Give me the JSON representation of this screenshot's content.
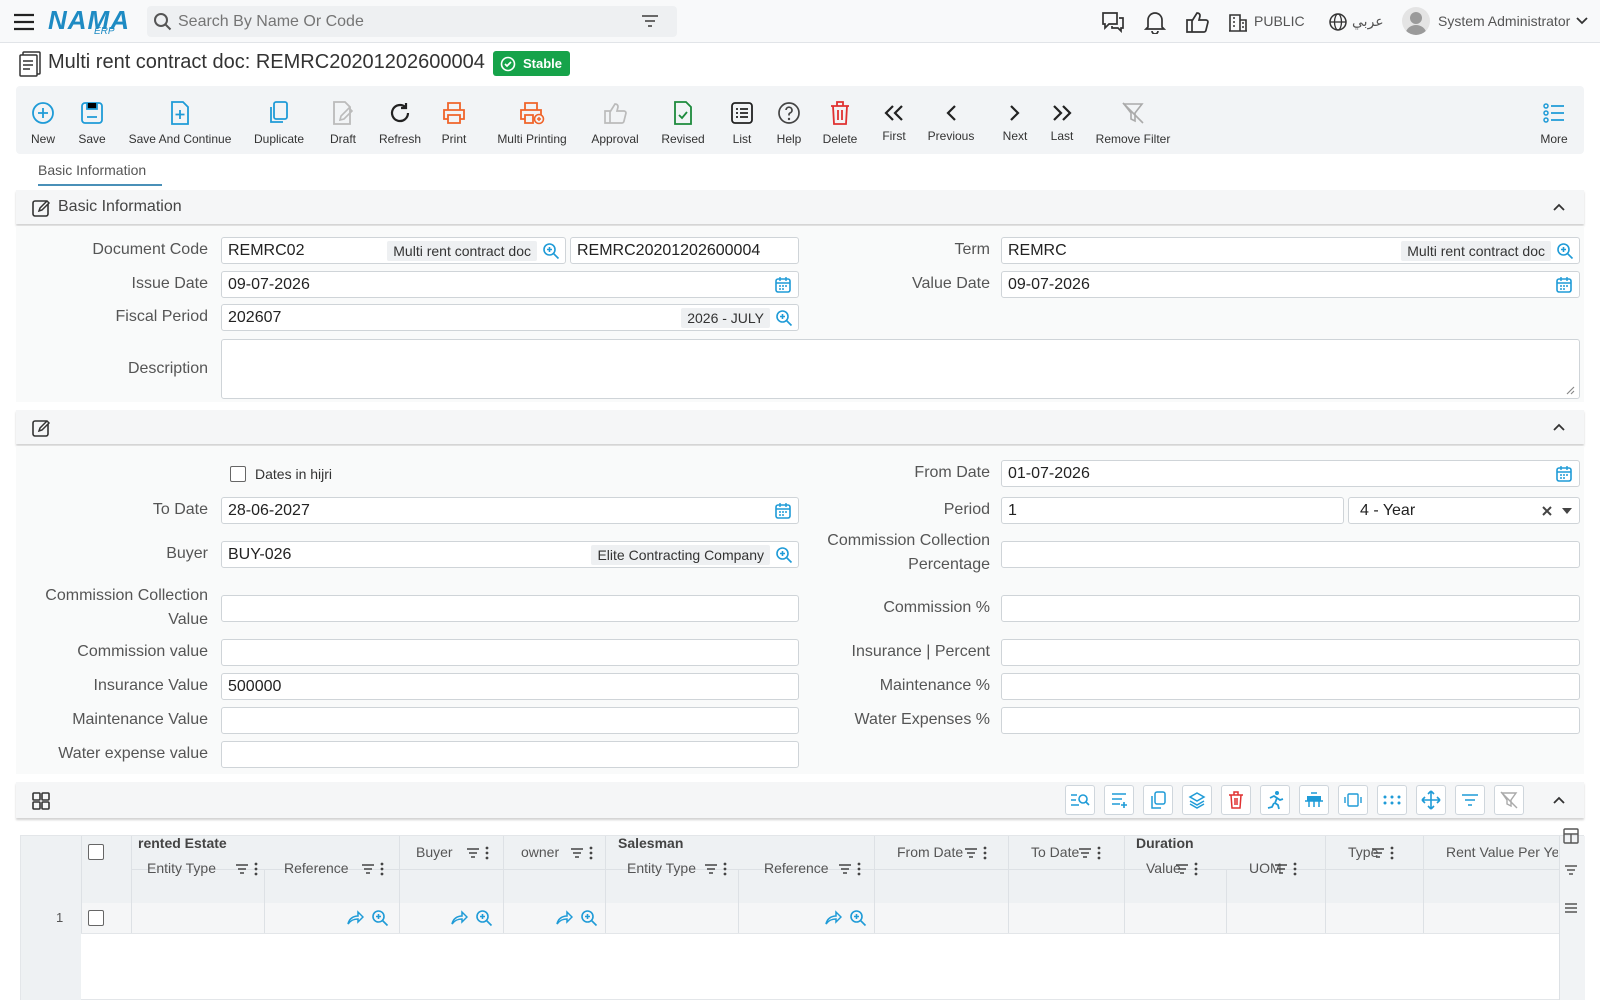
{
  "header": {
    "logo": "NAMA",
    "logo_sub": "ERP",
    "search_placeholder": "Search By Name Or Code",
    "public_label": "PUBLIC",
    "lang_label": "عربي",
    "user_name": "System Administrator"
  },
  "page": {
    "title": "Multi rent contract doc: REMRC20201202600004",
    "status": "Stable"
  },
  "toolbar": {
    "new": "New",
    "save": "Save",
    "save_continue": "Save And Continue",
    "duplicate": "Duplicate",
    "draft": "Draft",
    "refresh": "Refresh",
    "print": "Print",
    "multi_printing": "Multi Printing",
    "approval": "Approval",
    "revised": "Revised",
    "list": "List",
    "help": "Help",
    "delete": "Delete",
    "first": "First",
    "previous": "Previous",
    "next": "Next",
    "last": "Last",
    "remove_filter": "Remove Filter",
    "more": "More"
  },
  "tabs": {
    "basic": "Basic Information"
  },
  "section1": {
    "title": "Basic Information"
  },
  "fields": {
    "doc_code_label": "Document Code",
    "doc_code": "REMRC02",
    "doc_code_tag": "Multi rent contract doc",
    "doc_number": "REMRC20201202600004",
    "term_label": "Term",
    "term": "REMRC",
    "term_tag": "Multi rent contract doc",
    "issue_date_label": "Issue Date",
    "issue_date": "09-07-2026",
    "value_date_label": "Value Date",
    "value_date": "09-07-2026",
    "fiscal_label": "Fiscal Period",
    "fiscal": "202607",
    "fiscal_tag": "2026 - JULY",
    "desc_label": "Description",
    "hijri_label": "Dates in hijri",
    "from_date_label": "From Date",
    "from_date": "01-07-2026",
    "to_date_label": "To Date",
    "to_date": "28-06-2027",
    "period_label": "Period",
    "period": "1",
    "period_unit": "4 - Year",
    "buyer_label": "Buyer",
    "buyer": "BUY-026",
    "buyer_tag": "Elite Contracting Company",
    "ccp_label1": "Commission Collection",
    "ccp_label2": "Percentage",
    "ccv_label1": "Commission Collection",
    "ccv_label2": "Value",
    "commission_pct_label": "Commission %",
    "commission_value_label": "Commission value",
    "insurance_pct_label": "Insurance | Percent",
    "insurance_value_label": "Insurance Value",
    "insurance_value": "500000",
    "maintenance_pct_label": "Maintenance %",
    "maintenance_value_label": "Maintenance Value",
    "water_pct_label": "Water Expenses %",
    "water_value_label": "Water expense value"
  },
  "grid": {
    "rented_estate": "rented Estate",
    "entity_type": "Entity Type",
    "reference": "Reference",
    "buyer": "Buyer",
    "owner": "owner",
    "salesman": "Salesman",
    "from_date": "From Date",
    "to_date": "To Date",
    "duration": "Duration",
    "value": "Value",
    "uom": "UOM",
    "type": "Type",
    "rent_value": "Rent Value Per Ye",
    "row_number": "1"
  },
  "colors": {
    "accent": "#1f9bd7",
    "status_green": "#16a34a",
    "print_orange": "#f0642a",
    "delete_red": "#e03131"
  }
}
